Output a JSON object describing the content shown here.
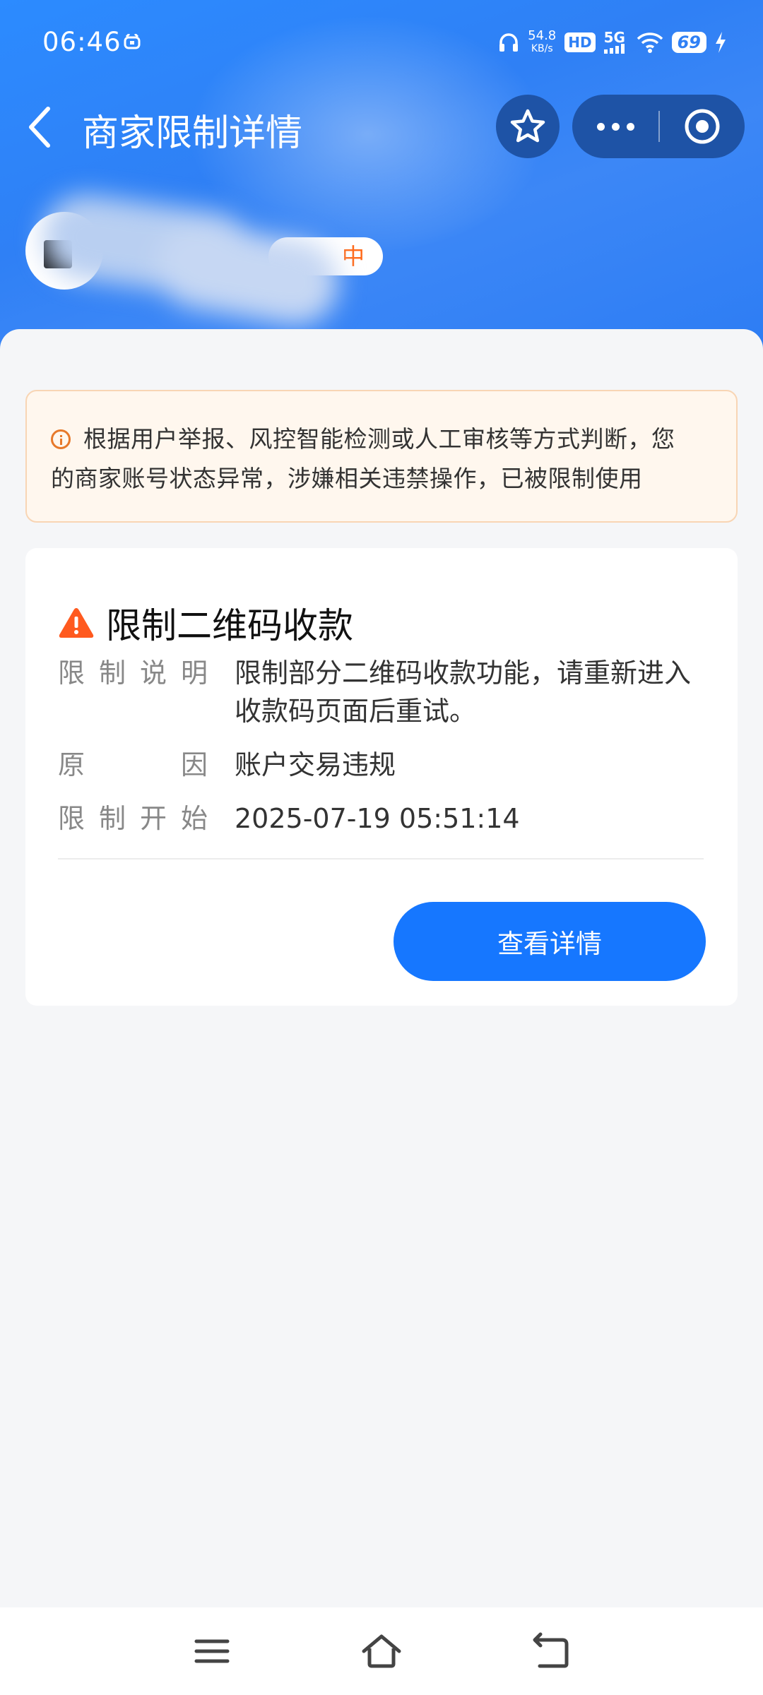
{
  "status_bar": {
    "time": "06:46",
    "net_speed_value": "54.8",
    "net_speed_unit": "KB/s",
    "hd": "HD",
    "network": "5G",
    "battery": "69"
  },
  "header": {
    "title": "商家限制详情"
  },
  "merchant": {
    "status_fragment": "中"
  },
  "notice": {
    "text": "根据用户举报、风控智能检测或人工审核等方式判断，您的商家账号状态异常，涉嫌相关违禁操作，已被限制使用"
  },
  "restriction": {
    "title": "限制二维码收款",
    "rows": [
      {
        "label_chars": [
          "限",
          "制",
          "说",
          "明"
        ],
        "value": "限制部分二维码收款功能，请重新进入收款码页面后重试。"
      },
      {
        "label_chars": [
          "原",
          "因"
        ],
        "value": "账户交易违规"
      },
      {
        "label_chars": [
          "限",
          "制",
          "开",
          "始"
        ],
        "value": "2025-07-19 05:51:14"
      }
    ],
    "button_label": "查看详情"
  },
  "colors": {
    "header_blue": "#2F80F5",
    "primary_button": "#1677FF",
    "warning_orange": "#FF6A1A",
    "notice_bg": "#FFF7EE"
  },
  "icons": [
    "alarm-icon",
    "headphones-icon",
    "wifi-icon",
    "charging-icon",
    "back-arrow-icon",
    "star-icon",
    "more-dots-icon",
    "target-icon",
    "info-icon",
    "warning-icon",
    "menu-icon",
    "home-icon",
    "back-icon"
  ]
}
